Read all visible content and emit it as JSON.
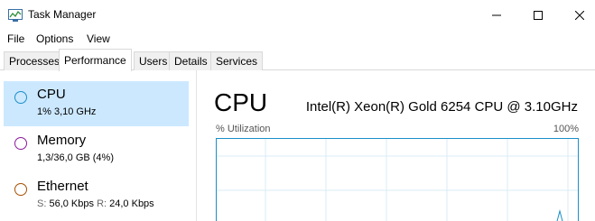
{
  "window": {
    "title": "Task Manager",
    "icon": "task-manager-icon"
  },
  "menu": {
    "items": [
      "File",
      "Options",
      "View"
    ]
  },
  "tabs": [
    {
      "label": "Processes",
      "active": false
    },
    {
      "label": "Performance",
      "active": true
    },
    {
      "label": "Users",
      "active": false
    },
    {
      "label": "Details",
      "active": false
    },
    {
      "label": "Services",
      "active": false
    }
  ],
  "resources": [
    {
      "name": "CPU",
      "detail": "1% 3,10 GHz",
      "color": "#1a8fc9",
      "selected": true
    },
    {
      "name": "Memory",
      "detail": "1,3/36,0 GB (4%)",
      "color": "#8b1a9b",
      "selected": false
    },
    {
      "name": "Ethernet",
      "send_label": "S:",
      "send_value": "56,0 Kbps",
      "recv_label": "R:",
      "recv_value": "24,0 Kbps",
      "color": "#a74f01",
      "selected": false
    }
  ],
  "detail": {
    "title": "CPU",
    "model": "Intel(R) Xeon(R) Gold 6254 CPU @ 3.10GHz",
    "util_label": "% Utilization",
    "util_max": "100%"
  },
  "colors": {
    "accent": "#1a8fc9",
    "selected_bg": "#cce8ff",
    "grid": "#d8ecf6"
  }
}
